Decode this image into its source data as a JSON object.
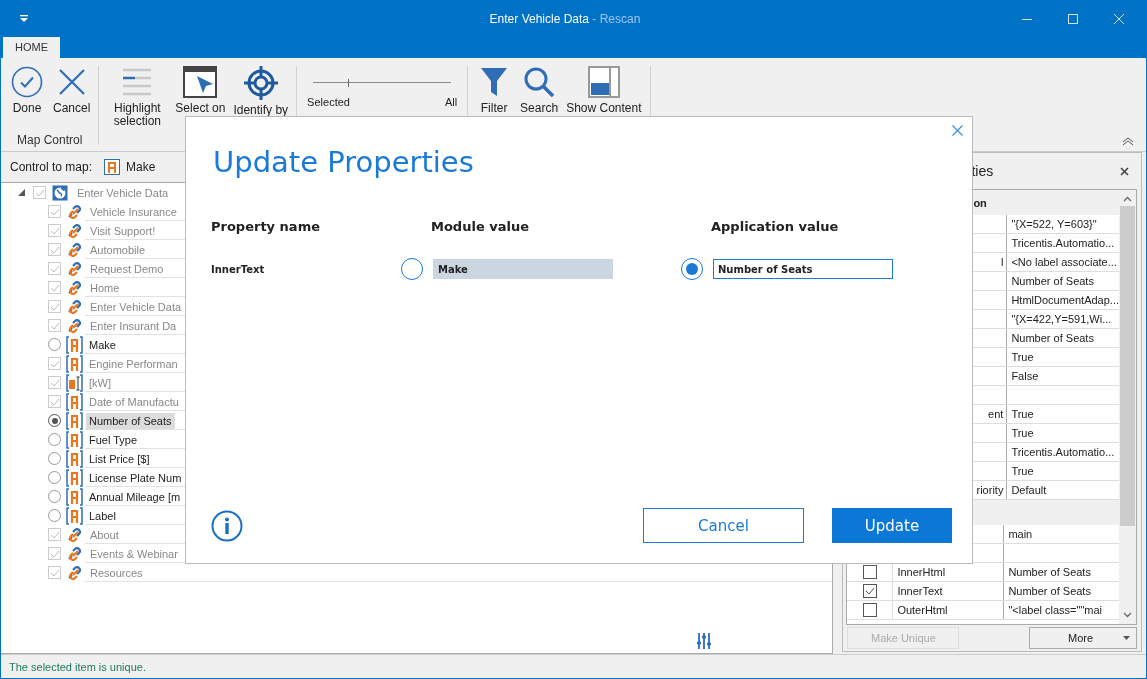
{
  "window": {
    "title": "Enter Vehicle Data",
    "subtitle": " - Rescan"
  },
  "tabs": [
    {
      "label": "HOME",
      "selected": true
    }
  ],
  "ribbon": {
    "groups": [
      {
        "label": "Map Control",
        "buttons": [
          {
            "label": "Done"
          },
          {
            "label": "Cancel"
          }
        ]
      },
      {
        "buttons": [
          {
            "label": "Highlight selection"
          },
          {
            "label": "Select on"
          },
          {
            "label": "Identify by"
          }
        ]
      },
      {
        "slider": {
          "level": 0.25,
          "min_label": "Selected",
          "max_label": "All"
        }
      },
      {
        "buttons": [
          {
            "label": "Filter"
          },
          {
            "label": "Search"
          },
          {
            "label": "Show Content"
          }
        ]
      }
    ]
  },
  "control_to_map": {
    "label": "Control to map:",
    "value": "Make"
  },
  "tree": {
    "text": "Enter Vehicle Data",
    "checked": true,
    "disabled": true,
    "expanded": true,
    "children": [
      {
        "text": "Vehicle Insurance",
        "kind": "link",
        "checked": true,
        "disabled": true
      },
      {
        "text": "Visit Support!",
        "kind": "link",
        "checked": true,
        "disabled": true
      },
      {
        "text": "Automobile",
        "kind": "link",
        "checked": true,
        "disabled": true
      },
      {
        "text": "Request Demo",
        "kind": "link",
        "checked": true,
        "disabled": true
      },
      {
        "text": "Home",
        "kind": "link",
        "checked": true,
        "disabled": true
      },
      {
        "text": "Enter Vehicle Data",
        "kind": "link",
        "checked": true,
        "disabled": true
      },
      {
        "text": "Enter Insurant Da",
        "kind": "link",
        "checked": true,
        "disabled": true
      },
      {
        "text": "Make",
        "kind": "label",
        "selected": false,
        "disabled": false
      },
      {
        "text": "Engine Performan",
        "kind": "label",
        "checked": true,
        "disabled": true
      },
      {
        "text": "[kW]",
        "kind": "input",
        "checked": true,
        "disabled": true
      },
      {
        "text": "Date of Manufactu",
        "kind": "label",
        "checked": true,
        "disabled": true
      },
      {
        "text": "Number of Seats",
        "kind": "label",
        "selected": true,
        "disabled": false
      },
      {
        "text": "Fuel Type",
        "kind": "label",
        "selected": false,
        "disabled": false
      },
      {
        "text": "List Price [$]",
        "kind": "label",
        "selected": false,
        "disabled": false
      },
      {
        "text": "License Plate Num",
        "kind": "label",
        "selected": false,
        "disabled": false
      },
      {
        "text": "Annual Mileage [m",
        "kind": "label",
        "selected": false,
        "disabled": false
      },
      {
        "text": "Label",
        "kind": "label",
        "selected": false,
        "disabled": false
      },
      {
        "text": "About",
        "kind": "link",
        "checked": true,
        "disabled": true
      },
      {
        "text": "Events & Webinar",
        "kind": "link",
        "checked": true,
        "disabled": true
      },
      {
        "text": "Resources",
        "kind": "link",
        "checked": true,
        "disabled": true
      }
    ]
  },
  "properties_panel": {
    "title": "ties",
    "sections": [
      {
        "header": "on",
        "rows": [
          {
            "value": "\"{X=522, Y=603}\""
          },
          {
            "value": "Tricentis.Automatio..."
          },
          {
            "name": "l",
            "value": "<No label associate..."
          },
          {
            "value": "Number of Seats"
          },
          {
            "value": "HtmlDocumentAdap..."
          },
          {
            "value": "\"{X=422,Y=591,Wi..."
          },
          {
            "value": "Number of Seats"
          },
          {
            "value": "True"
          },
          {
            "value": "False"
          },
          {},
          {
            "name": "ent",
            "value": "True"
          },
          {
            "value": "True"
          },
          {
            "value": "Tricentis.Automatio..."
          },
          {
            "value": "True"
          },
          {
            "name": "riority",
            "value": "Default"
          }
        ]
      },
      {
        "rows": [
          {
            "value": "main"
          },
          {},
          {
            "name": "InnerHtml",
            "value": "Number of Seats",
            "checked": false
          },
          {
            "name": "InnerText",
            "value": "Number of Seats",
            "checked": true
          },
          {
            "name": "OuterHtml",
            "value": "\"<label class=\"\"mai",
            "checked": false
          }
        ]
      }
    ],
    "buttons": [
      {
        "label": "Make Unique",
        "disabled": true
      },
      {
        "label": "More",
        "disabled": false
      }
    ]
  },
  "status_bar": "The selected item is unique.",
  "dialog": {
    "title": "Update Properties",
    "columns": [
      "Property name",
      "Module value",
      "Application value"
    ],
    "rows": [
      {
        "property": "InnerText",
        "module_value": "Make",
        "module_selected": false,
        "application_value": "Number of Seats",
        "application_selected": true
      }
    ],
    "buttons": [
      {
        "label": "Cancel",
        "kind": "secondary"
      },
      {
        "label": "Update",
        "kind": "primary"
      }
    ]
  }
}
